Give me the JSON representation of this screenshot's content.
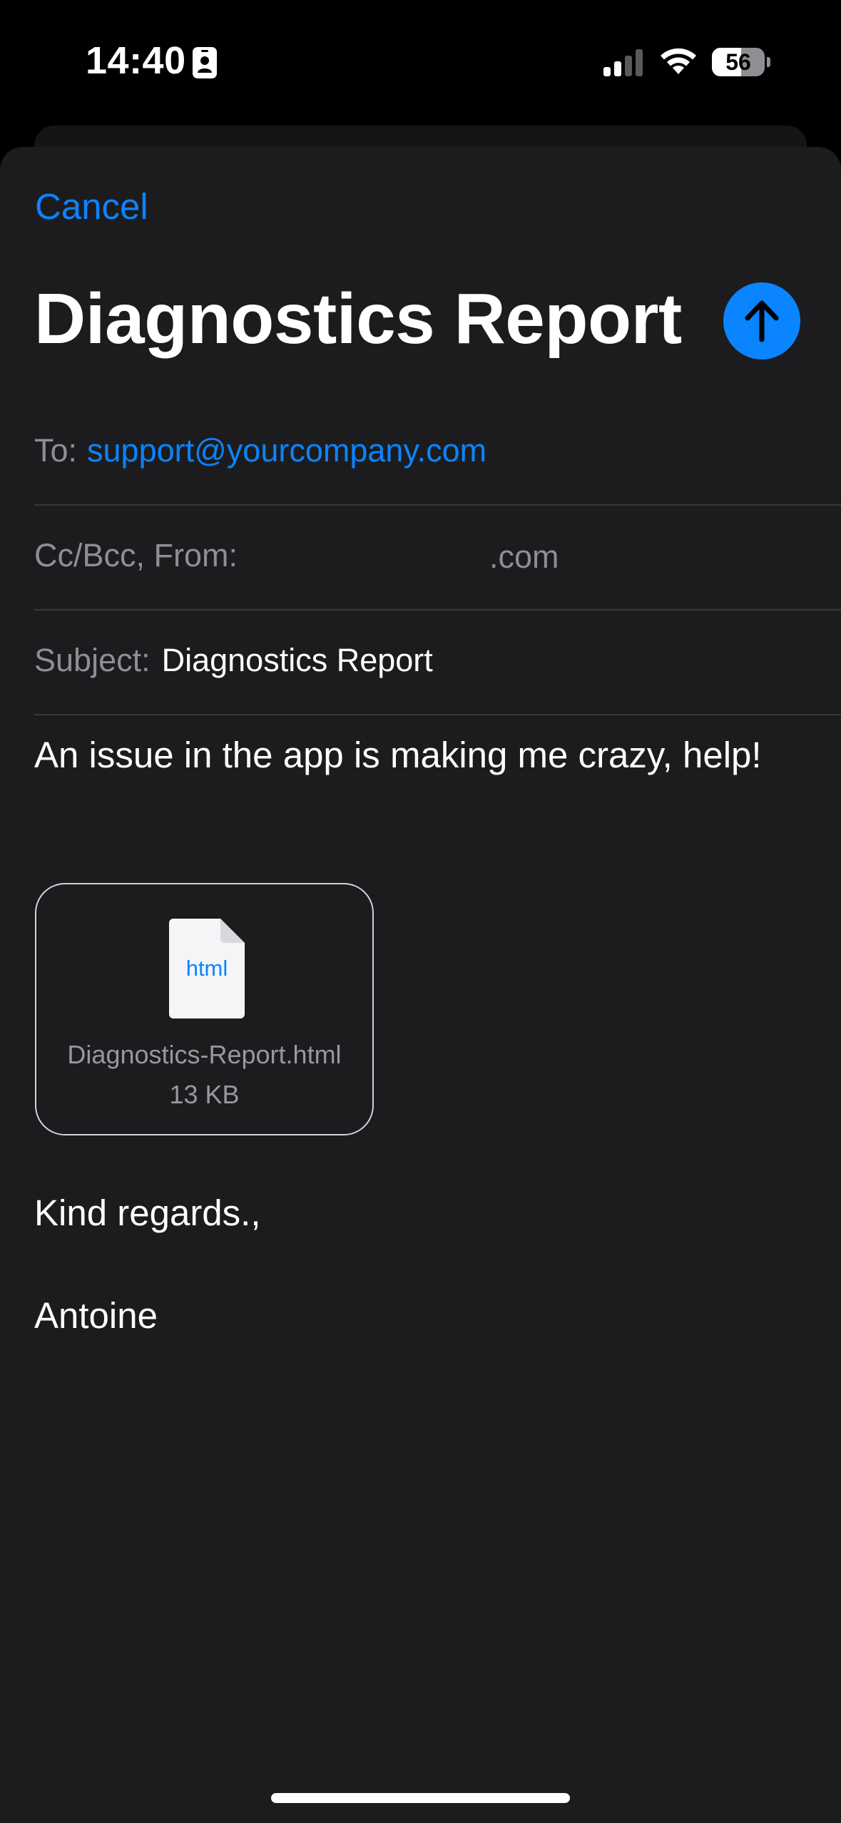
{
  "status_bar": {
    "time": "14:40",
    "battery_percent": "56",
    "battery_level": 0.56,
    "icons": [
      "contact-card-icon",
      "cellular-signal-icon",
      "wifi-icon",
      "battery-icon"
    ]
  },
  "compose": {
    "cancel_label": "Cancel",
    "title": "Diagnostics Report",
    "send_icon": "arrow-up-icon",
    "to_label": "To:",
    "to_value": "support@yourcompany.com",
    "ccbcc_label": "Cc/Bcc, From:",
    "from_value": ".com",
    "subject_label": "Subject:",
    "subject_value": "Diagnostics Report",
    "body_first_line": "An issue in the app is making me crazy, help!",
    "attachment": {
      "icon_label": "html",
      "file_name": "Diagnostics-Report.html",
      "file_size": "13 KB"
    },
    "sign_off": "Kind regards.,",
    "signature_name": "Antoine"
  },
  "colors": {
    "accent": "#0a84ff",
    "sheet_background": "#1c1c1e",
    "secondary_text": "#8e8e93",
    "separator": "#38383a"
  }
}
